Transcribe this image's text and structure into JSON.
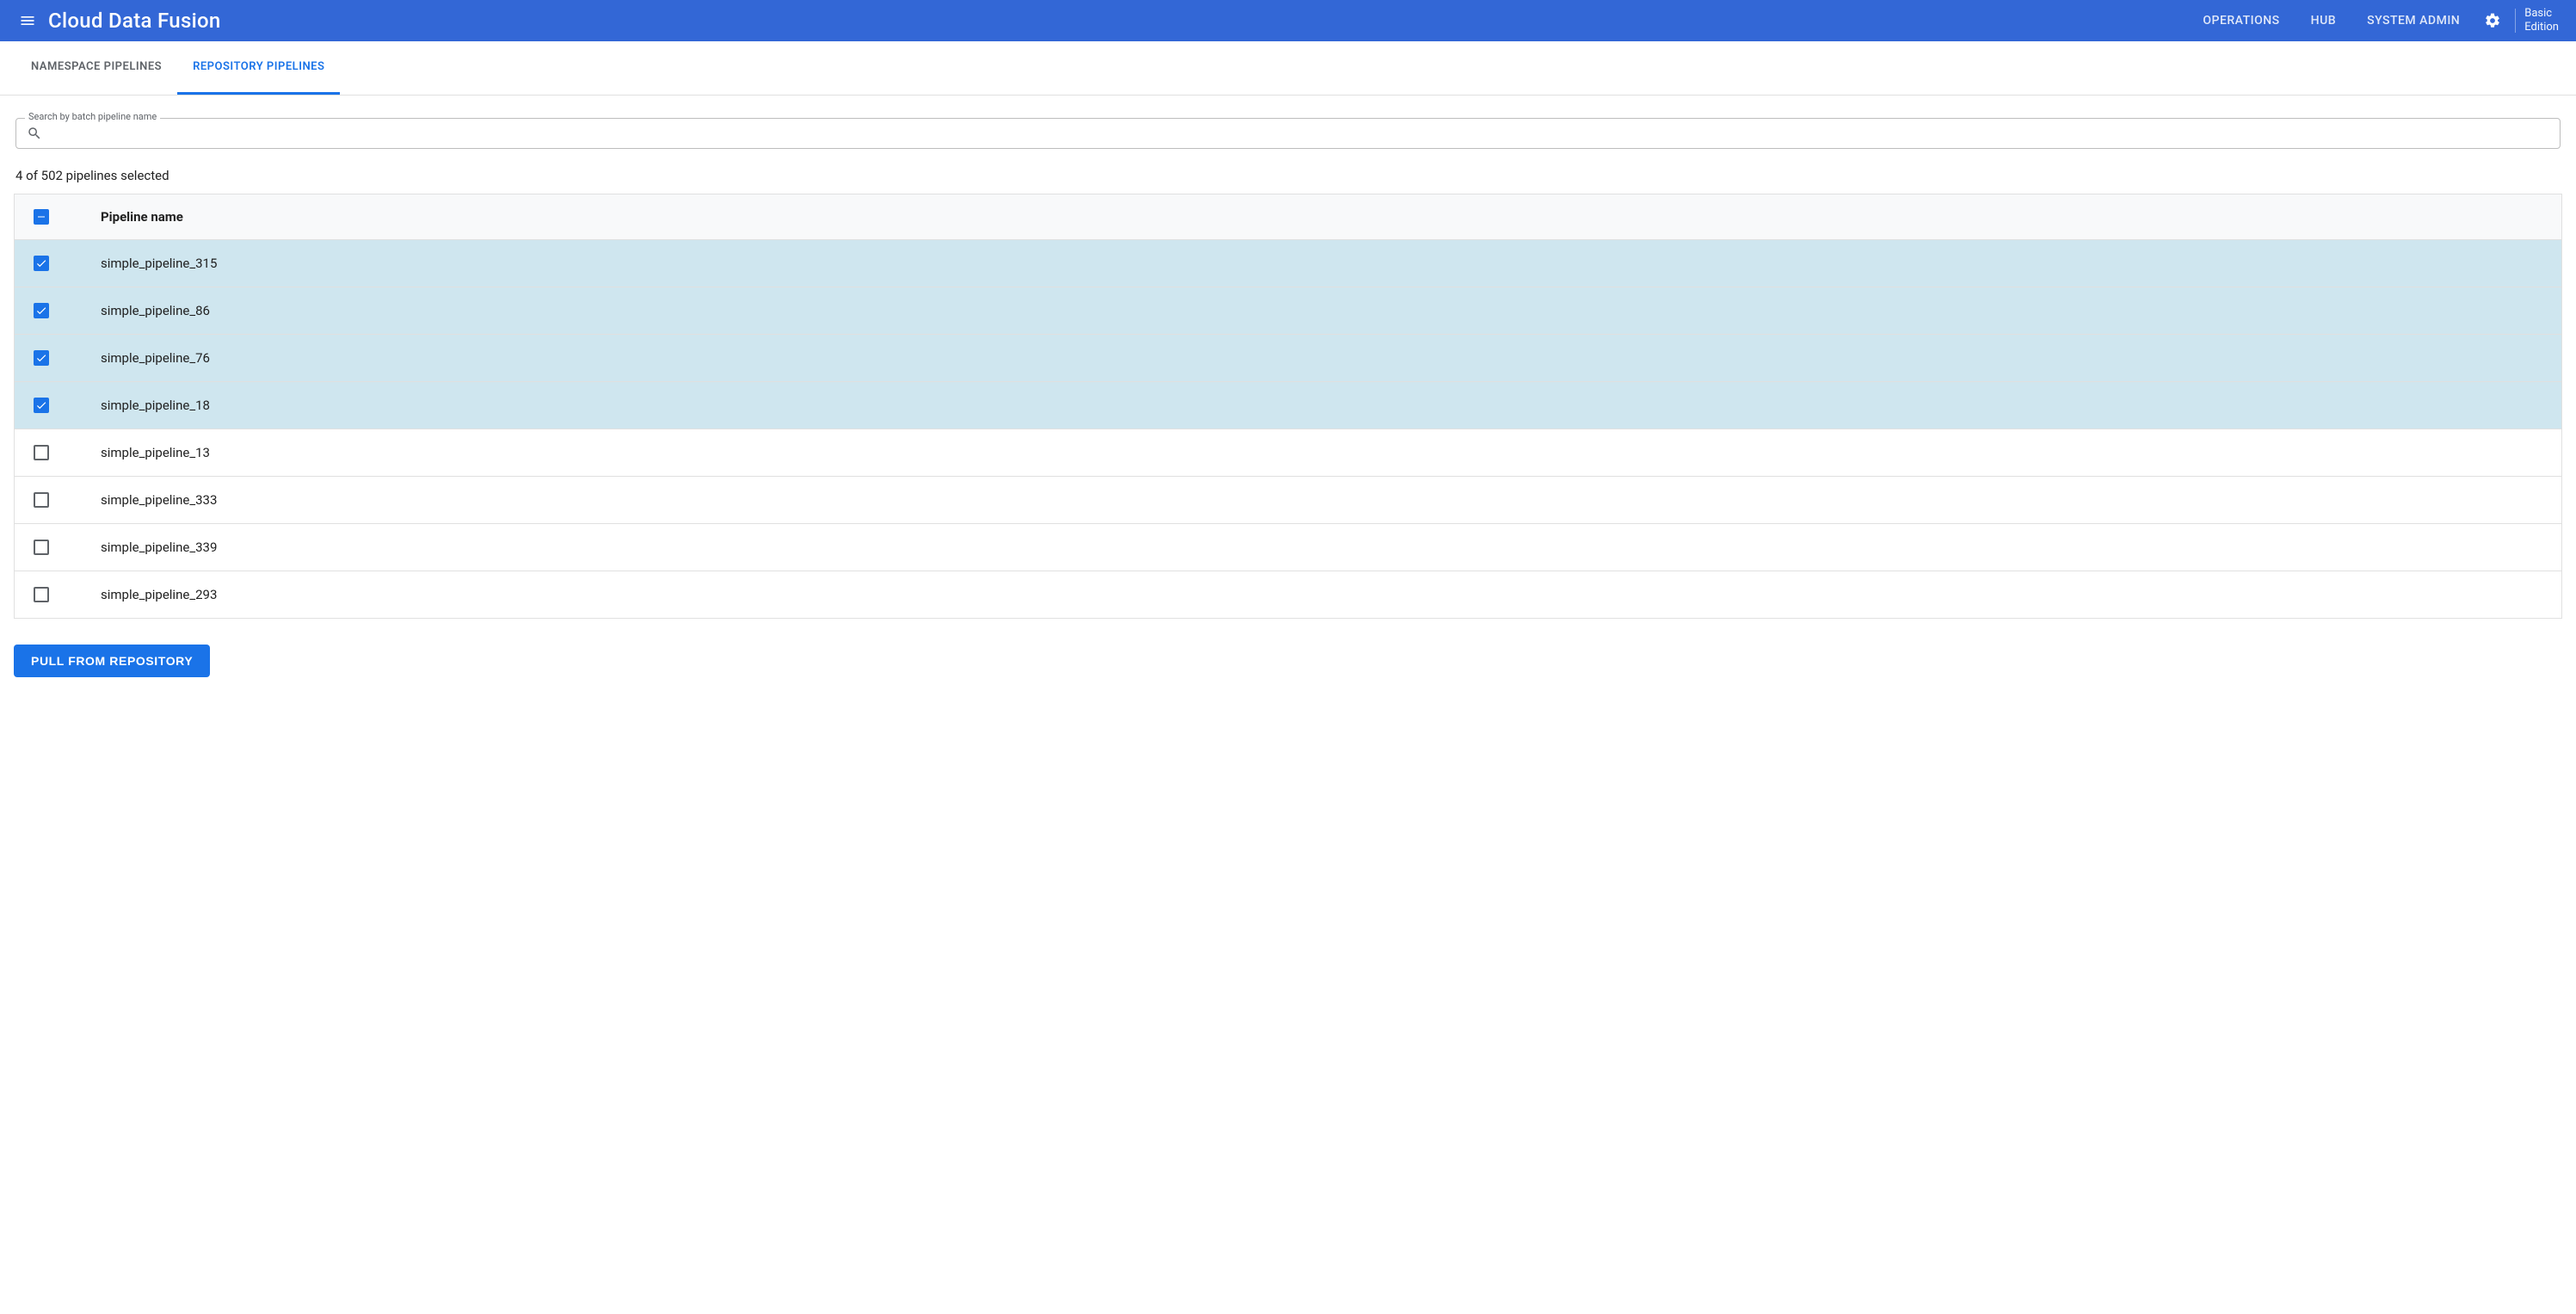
{
  "header": {
    "app_title": "Cloud Data Fusion",
    "nav": [
      {
        "label": "OPERATIONS"
      },
      {
        "label": "HUB"
      },
      {
        "label": "SYSTEM ADMIN"
      }
    ],
    "edition_line1": "Basic",
    "edition_line2": "Edition"
  },
  "tabs": [
    {
      "label": "NAMESPACE PIPELINES",
      "active": false
    },
    {
      "label": "REPOSITORY PIPELINES",
      "active": true
    }
  ],
  "search": {
    "float_label": "Search by batch pipeline name",
    "value": ""
  },
  "selection_status": "4 of 502 pipelines selected",
  "table": {
    "header_name": "Pipeline name",
    "rows": [
      {
        "name": "simple_pipeline_315",
        "selected": true
      },
      {
        "name": "simple_pipeline_86",
        "selected": true
      },
      {
        "name": "simple_pipeline_76",
        "selected": true
      },
      {
        "name": "simple_pipeline_18",
        "selected": true
      },
      {
        "name": "simple_pipeline_13",
        "selected": false
      },
      {
        "name": "simple_pipeline_333",
        "selected": false
      },
      {
        "name": "simple_pipeline_339",
        "selected": false
      },
      {
        "name": "simple_pipeline_293",
        "selected": false
      }
    ]
  },
  "footer": {
    "pull_button": "PULL FROM REPOSITORY"
  }
}
